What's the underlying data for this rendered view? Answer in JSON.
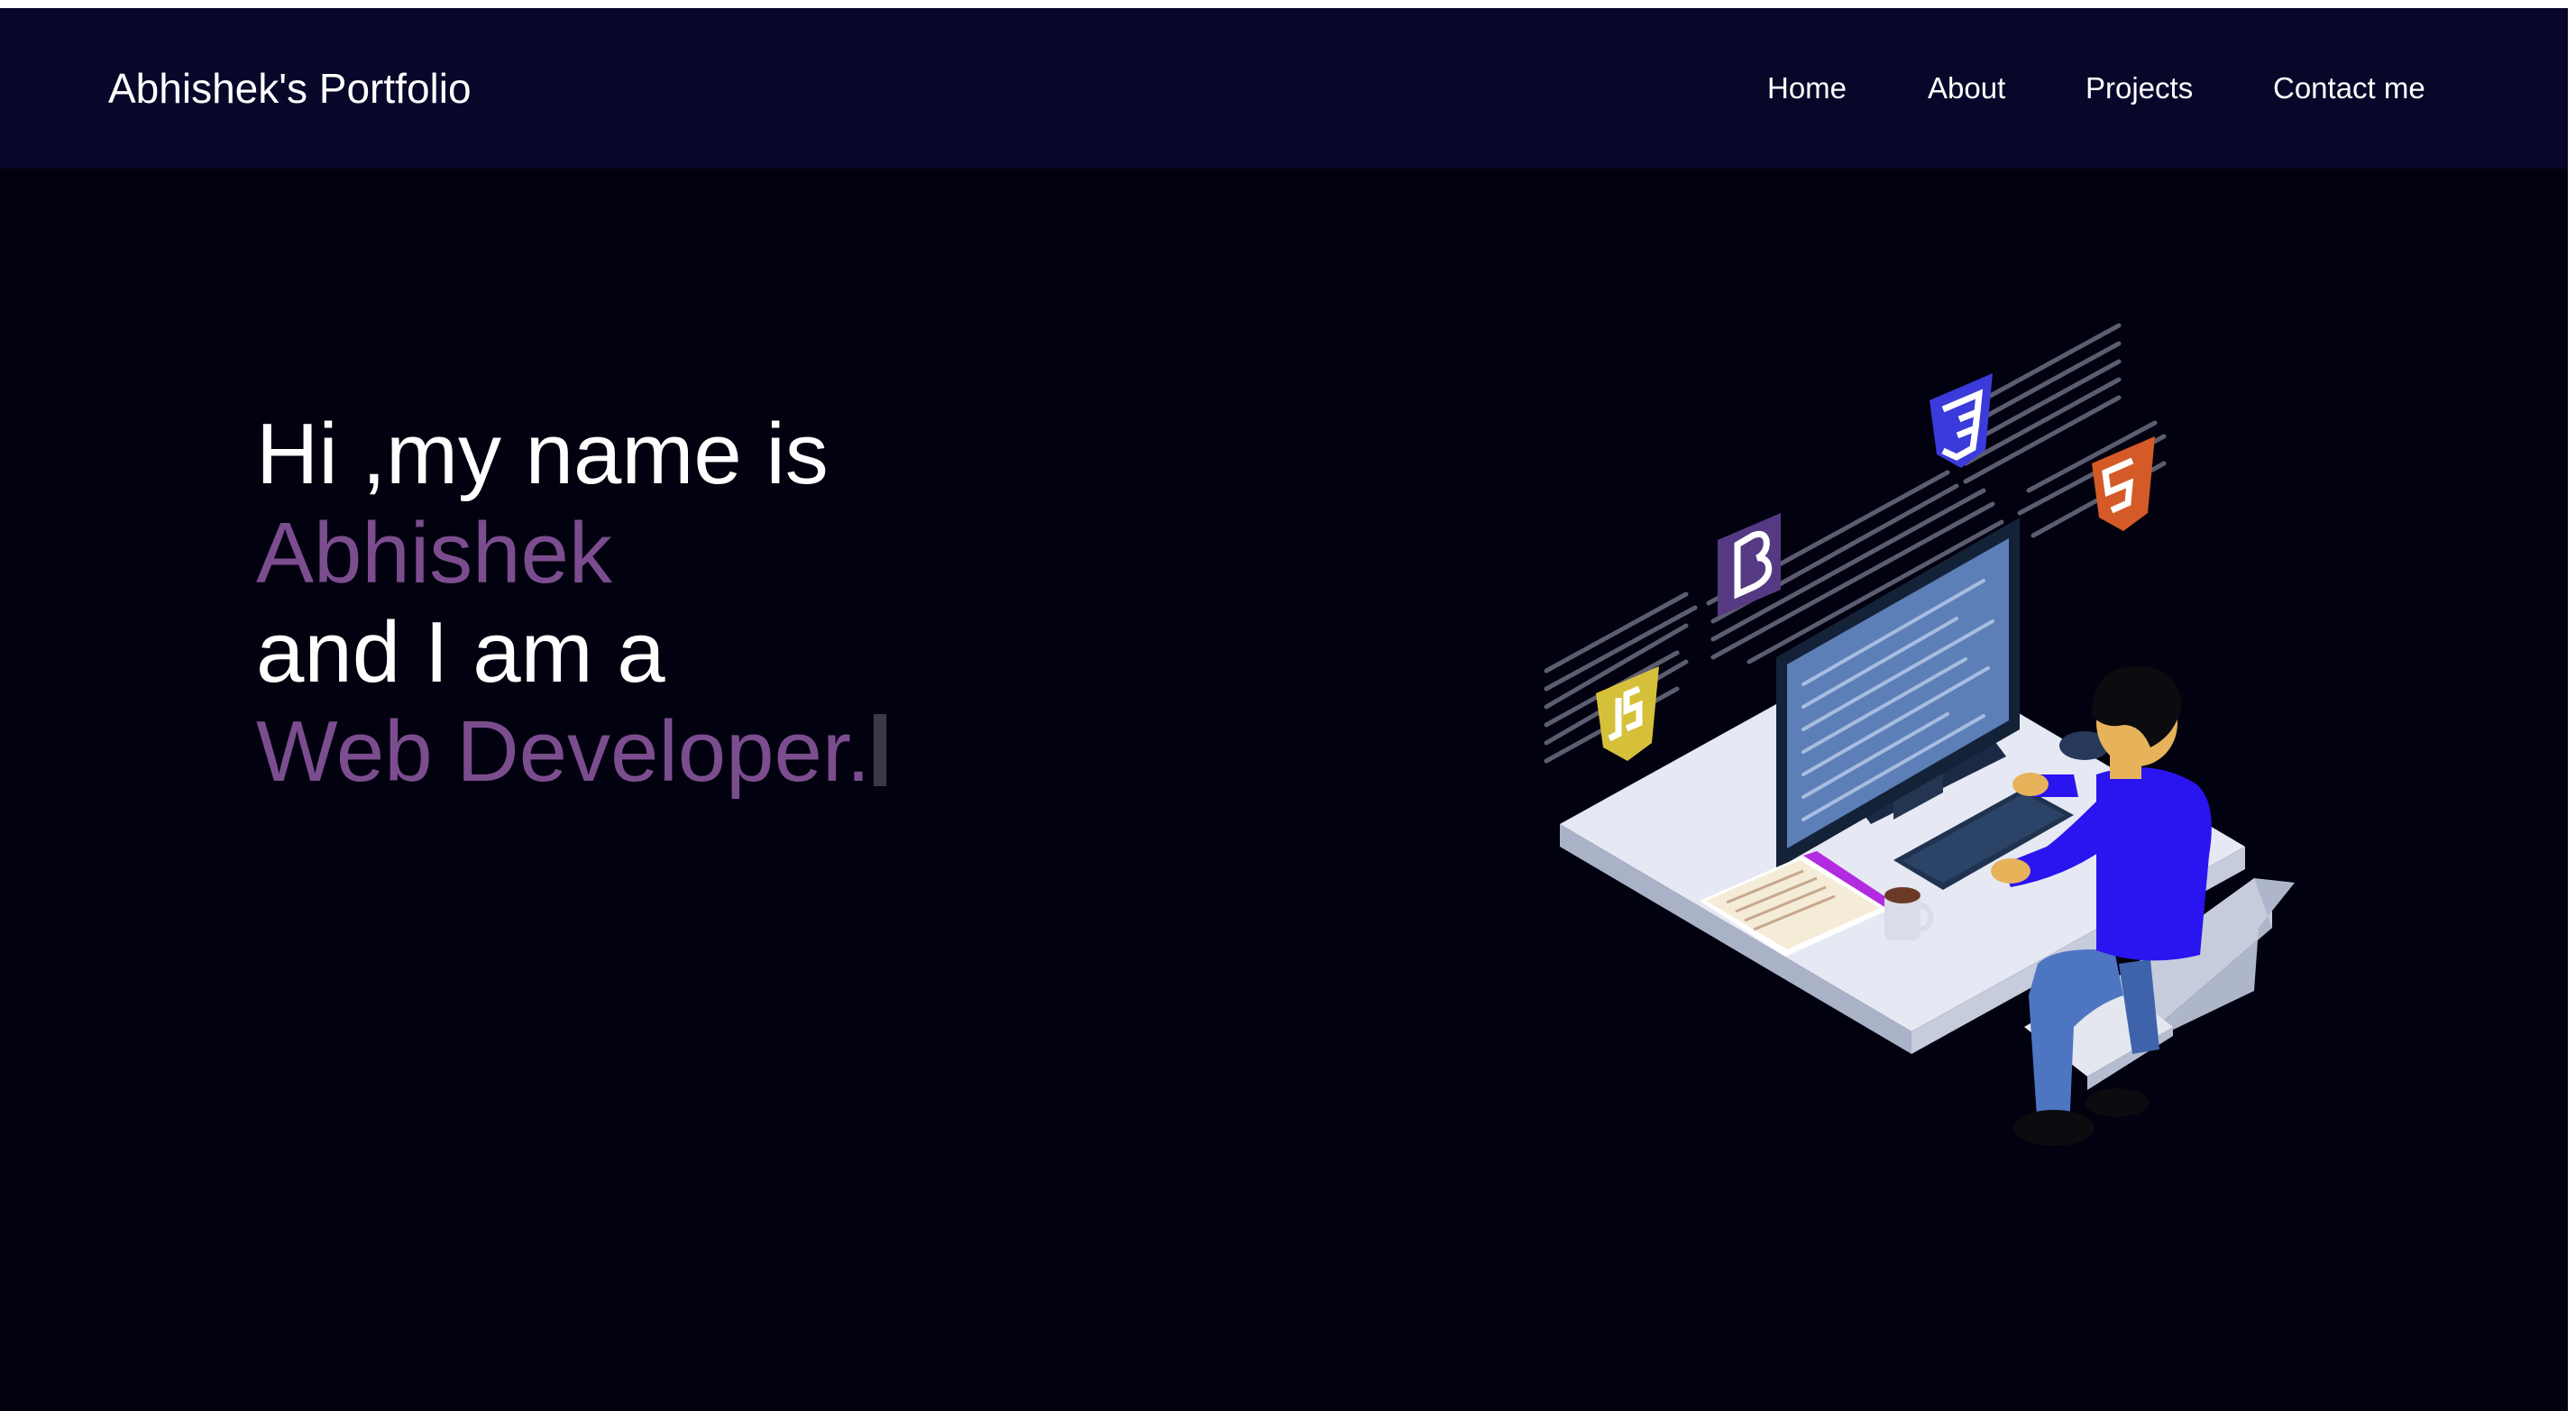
{
  "header": {
    "brand": "Abhishek's Portfolio",
    "nav": [
      {
        "label": "Home"
      },
      {
        "label": "About"
      },
      {
        "label": "Projects"
      },
      {
        "label": "Contact me"
      }
    ]
  },
  "hero": {
    "line1": "Hi ,my name is",
    "name": "Abhishek",
    "line3": "and I am a",
    "role": "Web Developer."
  },
  "illustration": {
    "icons": [
      "css3-icon",
      "html5-icon",
      "bootstrap-icon",
      "javascript-icon"
    ],
    "colors": {
      "accent_purple": "#7b4d8e",
      "nav_bg": "#08072a",
      "page_bg": "#02010f"
    }
  }
}
